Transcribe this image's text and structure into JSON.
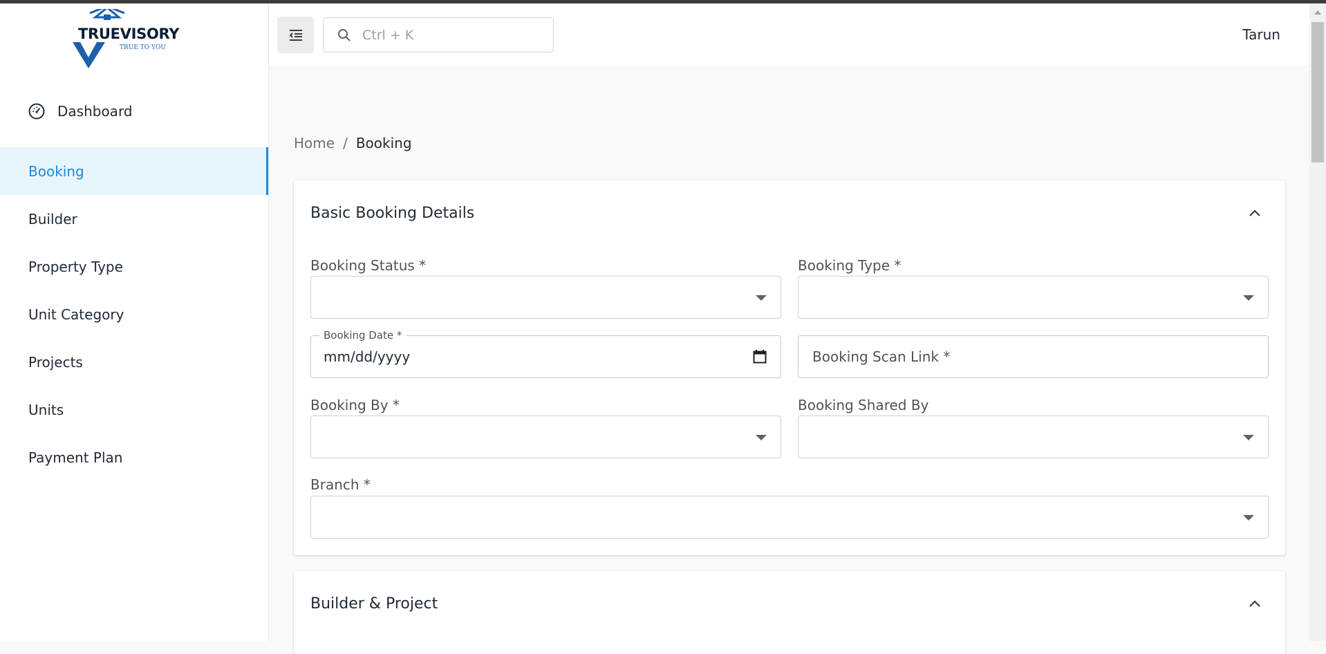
{
  "brand": {
    "name": "TRUEVISORY",
    "tagline": "TRUE TO YOU"
  },
  "sidebar": {
    "items": [
      {
        "label": "Dashboard",
        "icon": "speedometer-icon"
      },
      {
        "label": "Booking",
        "active": true
      },
      {
        "label": "Builder"
      },
      {
        "label": "Property Type"
      },
      {
        "label": "Unit Category"
      },
      {
        "label": "Projects"
      },
      {
        "label": "Units"
      },
      {
        "label": "Payment Plan"
      }
    ]
  },
  "header": {
    "menu_icon": "menu-collapse-icon",
    "search_placeholder": "Ctrl + K",
    "user_name": "Tarun"
  },
  "breadcrumb": {
    "home": "Home",
    "separator": "/",
    "current": "Booking"
  },
  "sections": [
    {
      "title": "Basic Booking Details",
      "fields": {
        "booking_status": {
          "label": "Booking Status *",
          "value": ""
        },
        "booking_type": {
          "label": "Booking Type *",
          "value": ""
        },
        "booking_date": {
          "label": "Booking Date *",
          "value": "mm/dd/yyyy"
        },
        "booking_scan_link": {
          "placeholder": "Booking Scan Link *"
        },
        "booking_by": {
          "label": "Booking By *",
          "value": ""
        },
        "booking_shared_by": {
          "label": "Booking Shared By",
          "value": ""
        },
        "branch": {
          "label": "Branch *",
          "value": ""
        }
      }
    },
    {
      "title": "Builder & Project"
    }
  ],
  "colors": {
    "accent": "#1a8ce0",
    "active_bg": "#e7f5fd",
    "logo_blue": "#1b5fae"
  }
}
